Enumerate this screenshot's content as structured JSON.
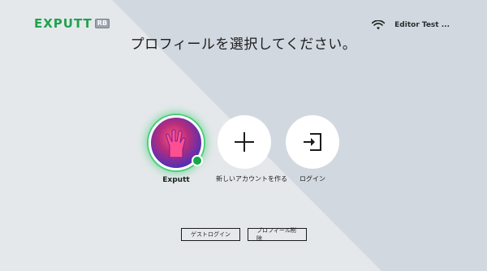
{
  "header": {
    "logo_main": "EXPUTT",
    "logo_badge": "RB",
    "user_name": "Editor Test ..."
  },
  "main": {
    "title": "プロフィールを選択してください。"
  },
  "profiles": [
    {
      "label": "Exputt",
      "icon": "avatar-hand-icon",
      "status": "online"
    },
    {
      "label": "新しいアカウントを作る",
      "icon": "plus-icon"
    },
    {
      "label": "ログイン",
      "icon": "login-icon"
    }
  ],
  "footer": {
    "guest_login_label": "ゲストログイン",
    "delete_profile_label": "プロフィール削除"
  },
  "colors": {
    "brand_green": "#1ea34d",
    "online": "#17a74a",
    "background": "#e5e8eb"
  }
}
